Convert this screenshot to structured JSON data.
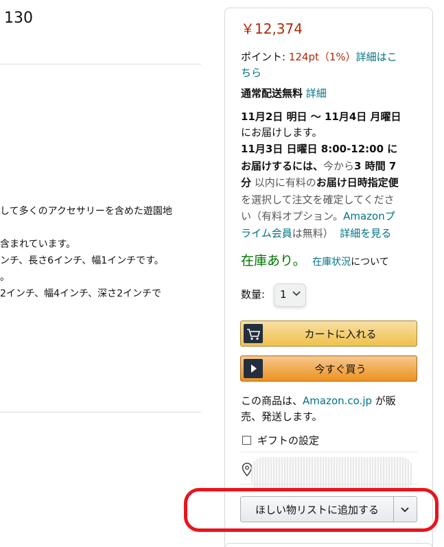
{
  "left": {
    "title_fragment": "130",
    "lines": [
      "して多くのアクセサリーを含めた遊園地",
      "含まれています。",
      "ンチ、長さ6インチ、幅1インチです。",
      "。",
      "2インチ、幅4インチ、深さ2インチで"
    ]
  },
  "buybox": {
    "price": "￥12,374",
    "points_label": "ポイント: ",
    "points_value": "124pt（1%）",
    "points_link_1": "詳細はこ",
    "points_link_2": "ちら",
    "shipping_label": "通常配送無料",
    "shipping_link": "詳細",
    "delivery_dates": "11月2日 明日 ～ 11月4日 月曜日",
    "delivery_suffix": "にお届けします。",
    "express_line1": "11月3日 日曜日 8:00-12:00 に",
    "express_line2_bold": "お届けするには、",
    "express_line2_gray": "今から",
    "express_line2_time": "3 時間 7",
    "express_line3_time": "分",
    "express_line3_gray": " 以内に有料の",
    "express_line3_bold": "お届け日時指定便",
    "express_line4": "を選択して注文を確定してくださ",
    "express_line5_gray": "い（有料オプション。",
    "express_line5_link": "Amazonプ",
    "express_line6_link": "ライム会員",
    "express_line6_gray": "は無料）",
    "express_line6_link2": "詳細を見る",
    "in_stock": "在庫あり。",
    "stock_link": "在庫状況",
    "stock_suffix": "について",
    "qty_label": "数量:",
    "qty_value": "1",
    "cart_button": "カートに入れる",
    "buy_now_button": "今すぐ買う",
    "sold_by_prefix": "この商品は、",
    "sold_by_link": "Amazon.co.jp",
    "sold_by_suffix1": " が販",
    "sold_by_suffix2": "売、発送します。",
    "gift_label": "ギフトの設定",
    "wishlist_button": "ほしい物リストに追加する"
  },
  "colors": {
    "price": "#b12704",
    "link": "#007185",
    "in_stock": "#007600",
    "highlight": "#e8141d"
  }
}
